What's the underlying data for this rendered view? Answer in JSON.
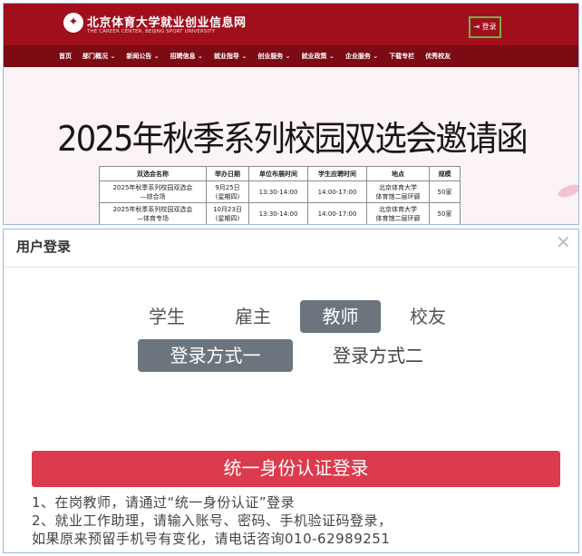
{
  "site": {
    "logo_title": "北京体育大学就业创业信息网",
    "logo_subtitle": "THE CAREER CENTER, BEIJING SPORT UNIVERSITY",
    "login_label": "登录",
    "nav": [
      {
        "label": "首页"
      },
      {
        "label": "部门概况 ⌄"
      },
      {
        "label": "新闻公告 ⌄"
      },
      {
        "label": "招聘信息 ⌄"
      },
      {
        "label": "就业指导 ⌄"
      },
      {
        "label": "创业服务 ⌄"
      },
      {
        "label": "就业政策 ⌄"
      },
      {
        "label": "企业服务 ⌄"
      },
      {
        "label": "下载专栏"
      },
      {
        "label": "优秀校友"
      }
    ],
    "banner_title": "2025年秋季系列校园双选会邀请函",
    "table": {
      "headers": [
        "双选会名称",
        "举办日期",
        "单位布展时间",
        "学生应聘时间",
        "地点",
        "规模"
      ],
      "rows": [
        {
          "name": [
            "2025年秋季系列校园双选会",
            "—综合场"
          ],
          "date": [
            "9月25日",
            "(星期四)"
          ],
          "setup": "13:30-14:00",
          "apply": "14:00-17:00",
          "place": [
            "北京体育大学",
            "体育馆二层环廊"
          ],
          "scale": "50家"
        },
        {
          "name": [
            "2025年秋季系列校园双选会",
            "—体育专场"
          ],
          "date": [
            "10月23日",
            "(星期四)"
          ],
          "setup": "13:30-14:00",
          "apply": "14:00-17:00",
          "place": [
            "北京体育大学",
            "体育馆二层环廊"
          ],
          "scale": "50家"
        }
      ]
    },
    "colors": {
      "header": "#a10f1c",
      "nav": "#7c0b14",
      "login_border": "#6fb24a"
    }
  },
  "dialog": {
    "title": "用户登录",
    "close_icon": "close-icon",
    "roles": [
      {
        "label": "学生",
        "active": false
      },
      {
        "label": "雇主",
        "active": false
      },
      {
        "label": "教师",
        "active": true
      },
      {
        "label": "校友",
        "active": false
      }
    ],
    "methods": [
      {
        "label": "登录方式一",
        "active": true
      },
      {
        "label": "登录方式二",
        "active": false
      }
    ],
    "sso_button": "统一身份认证登录",
    "notes": [
      "1、在岗教师，请通过“统一身份认证”登录",
      "2、就业工作助理，请输入账号、密码、手机验证码登录，",
      "如果原来预留手机号有变化，请电话咨询010-62989251"
    ],
    "colors": {
      "active_tab": "#6c757d",
      "sso_button": "#db3b4d"
    }
  }
}
